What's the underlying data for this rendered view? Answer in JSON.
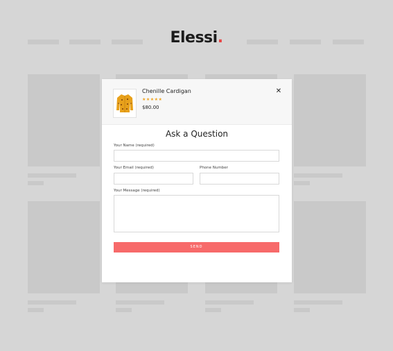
{
  "brand": {
    "name": "Elessi",
    "dot": "."
  },
  "product": {
    "name": "Chenille Cardigan",
    "rating": 4.5,
    "stars": "★★★★★",
    "price": "$80.00"
  },
  "dialog": {
    "title": "Ask a Question",
    "close_glyph": "✕",
    "name_label": "Your Name (required)",
    "email_label": "Your Email (required)",
    "phone_label": "Phone Number",
    "message_label": "Your Message (required)",
    "send_label": "SEND"
  },
  "colors": {
    "accent": "#f76a6a",
    "brand_dot": "#e84545",
    "stars": "#f0a422",
    "sweater": "#e8a11b"
  }
}
